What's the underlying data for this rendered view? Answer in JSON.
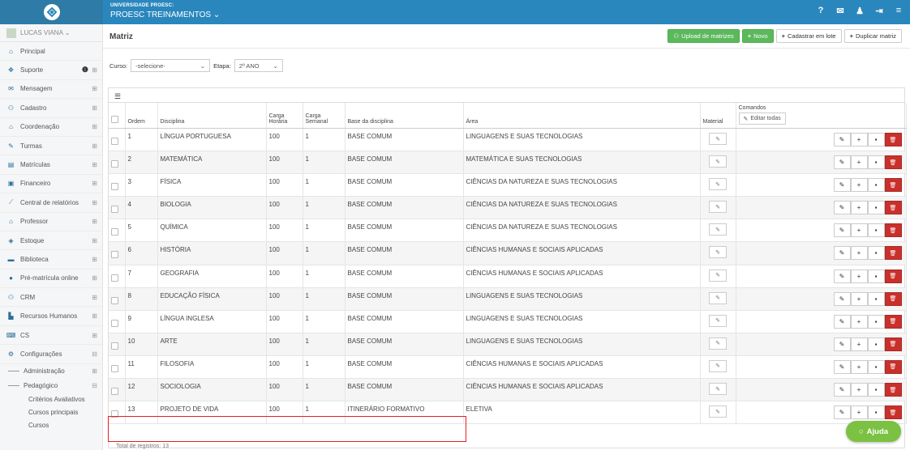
{
  "topbar": {
    "org_line1": "UNIVERSIDADE PROESC:",
    "org_line2": "PROESC TREINAMENTOS ⌄",
    "icons": [
      "help-icon",
      "mail-icon",
      "user-icon",
      "logout-icon",
      "menu-icon"
    ],
    "help_glyph": "?"
  },
  "sidebar": {
    "user": "LUCAS VIANA ⌄",
    "items": [
      {
        "label": "Principal",
        "icon": "home-icon",
        "glyph": "⌂",
        "expand": ""
      },
      {
        "label": "Suporte",
        "icon": "support-icon",
        "glyph": "✥",
        "expand": "⊞"
      },
      {
        "label": "Mensagem",
        "icon": "mail-icon",
        "glyph": "✉",
        "expand": "⊞"
      },
      {
        "label": "Cadastro",
        "icon": "users-icon",
        "glyph": "⚇",
        "expand": "⊞"
      },
      {
        "label": "Coordenação",
        "icon": "graduation-icon",
        "glyph": "⌂",
        "expand": "⊞"
      },
      {
        "label": "Turmas",
        "icon": "pencil-icon",
        "glyph": "✎",
        "expand": "⊞"
      },
      {
        "label": "Matrículas",
        "icon": "book-icon",
        "glyph": "▤",
        "expand": "⊞"
      },
      {
        "label": "Financeiro",
        "icon": "money-icon",
        "glyph": "▣",
        "expand": "⊞"
      },
      {
        "label": "Central de relatórios",
        "icon": "chart-icon",
        "glyph": "⟋",
        "expand": "⊞"
      },
      {
        "label": "Professor",
        "icon": "graduation-icon",
        "glyph": "⌂",
        "expand": "⊞"
      },
      {
        "label": "Estoque",
        "icon": "box-icon",
        "glyph": "◈",
        "expand": "⊞"
      },
      {
        "label": "Biblioteca",
        "icon": "library-icon",
        "glyph": "▬",
        "expand": "⊞"
      },
      {
        "label": "Pré-matrícula online",
        "icon": "globe-icon",
        "glyph": "●",
        "expand": "⊞"
      },
      {
        "label": "CRM",
        "icon": "users-icon",
        "glyph": "⚇",
        "expand": "⊞"
      },
      {
        "label": "Recursos Humanos",
        "icon": "flag-icon",
        "glyph": "▙",
        "expand": "⊞"
      },
      {
        "label": "CS",
        "icon": "cs-icon",
        "glyph": "⌨",
        "expand": "⊞"
      },
      {
        "label": "Configurações",
        "icon": "cogs-icon",
        "glyph": "⚙",
        "expand": "⊟"
      }
    ],
    "sub": [
      {
        "label": "Administração",
        "expand": "⊞"
      },
      {
        "label": "Pedagógico",
        "expand": "⊟"
      }
    ],
    "sub2": [
      "Critérios Avaliativos",
      "Cursos principais",
      "Cursos"
    ]
  },
  "page": {
    "title": "Matriz",
    "buttons": {
      "upload": "Upload de matrizes",
      "novo": "Novo",
      "cadastrar_lote": "Cadastrar em lote",
      "duplicar": "Duplicar matriz"
    },
    "filters": {
      "curso_label": "Curso:",
      "curso_value": "-selecione-",
      "etapa_label": "Etapa:",
      "etapa_value": "2º ANO"
    }
  },
  "table": {
    "headers": {
      "ordem": "Ordem",
      "disciplina": "Disciplina",
      "carga_horaria": "Carga Horária",
      "carga_semanal": "Carga Semanal",
      "base": "Base da disciplina",
      "area": "Área",
      "material": "Material",
      "comandos": "Comandos",
      "editar_todas": "Editar todas"
    },
    "rows": [
      {
        "ordem": "1",
        "disciplina": "LÍNGUA PORTUGUESA",
        "ch": "100",
        "cs": "1",
        "base": "BASE COMUM",
        "area": "LINGUAGENS E SUAS TECNOLOGIAS"
      },
      {
        "ordem": "2",
        "disciplina": "MATEMÁTICA",
        "ch": "100",
        "cs": "1",
        "base": "BASE COMUM",
        "area": "MATEMÁTICA E SUAS TECNOLOGIAS"
      },
      {
        "ordem": "3",
        "disciplina": "FÍSICA",
        "ch": "100",
        "cs": "1",
        "base": "BASE COMUM",
        "area": "CIÊNCIAS DA NATUREZA E SUAS TECNOLOGIAS"
      },
      {
        "ordem": "4",
        "disciplina": "BIOLOGIA",
        "ch": "100",
        "cs": "1",
        "base": "BASE COMUM",
        "area": "CIÊNCIAS DA NATUREZA E SUAS TECNOLOGIAS"
      },
      {
        "ordem": "5",
        "disciplina": "QUÍMICA",
        "ch": "100",
        "cs": "1",
        "base": "BASE COMUM",
        "area": "CIÊNCIAS DA NATUREZA E SUAS TECNOLOGIAS"
      },
      {
        "ordem": "6",
        "disciplina": "HISTÓRIA",
        "ch": "100",
        "cs": "1",
        "base": "BASE COMUM",
        "area": "CIÊNCIAS HUMANAS E SOCIAIS APLICADAS"
      },
      {
        "ordem": "7",
        "disciplina": "GEOGRAFIA",
        "ch": "100",
        "cs": "1",
        "base": "BASE COMUM",
        "area": "CIÊNCIAS HUMANAS E SOCIAIS APLICADAS"
      },
      {
        "ordem": "8",
        "disciplina": "EDUCAÇÃO FÍSICA",
        "ch": "100",
        "cs": "1",
        "base": "BASE COMUM",
        "area": "LINGUAGENS E SUAS TECNOLOGIAS"
      },
      {
        "ordem": "9",
        "disciplina": "LÍNGUA INGLESA",
        "ch": "100",
        "cs": "1",
        "base": "BASE COMUM",
        "area": "LINGUAGENS E SUAS TECNOLOGIAS"
      },
      {
        "ordem": "10",
        "disciplina": "ARTE",
        "ch": "100",
        "cs": "1",
        "base": "BASE COMUM",
        "area": "LINGUAGENS E SUAS TECNOLOGIAS"
      },
      {
        "ordem": "11",
        "disciplina": "FILOSOFIA",
        "ch": "100",
        "cs": "1",
        "base": "BASE COMUM",
        "area": "CIÊNCIAS HUMANAS E SOCIAIS APLICADAS"
      },
      {
        "ordem": "12",
        "disciplina": "SOCIOLOGIA",
        "ch": "100",
        "cs": "1",
        "base": "BASE COMUM",
        "area": "CIÊNCIAS HUMANAS E SOCIAIS APLICADAS"
      },
      {
        "ordem": "13",
        "disciplina": "PROJETO DE VIDA",
        "ch": "100",
        "cs": "1",
        "base": "ITINERÁRIO FORMATIVO",
        "area": "ELETIVA"
      }
    ],
    "material_glyph": "✎",
    "cmd_glyphs": {
      "edit": "✎",
      "add": "+",
      "save": "▪",
      "delete": "🗑"
    },
    "total": "Total de registros: 13"
  },
  "help": {
    "label": "Ajuda",
    "glyph": "○"
  },
  "colors": {
    "topbar": "#2a87bd",
    "accent_green": "#5cb85c",
    "danger": "#c9302c",
    "help_green": "#7bc142",
    "highlight": "#e31e24"
  }
}
